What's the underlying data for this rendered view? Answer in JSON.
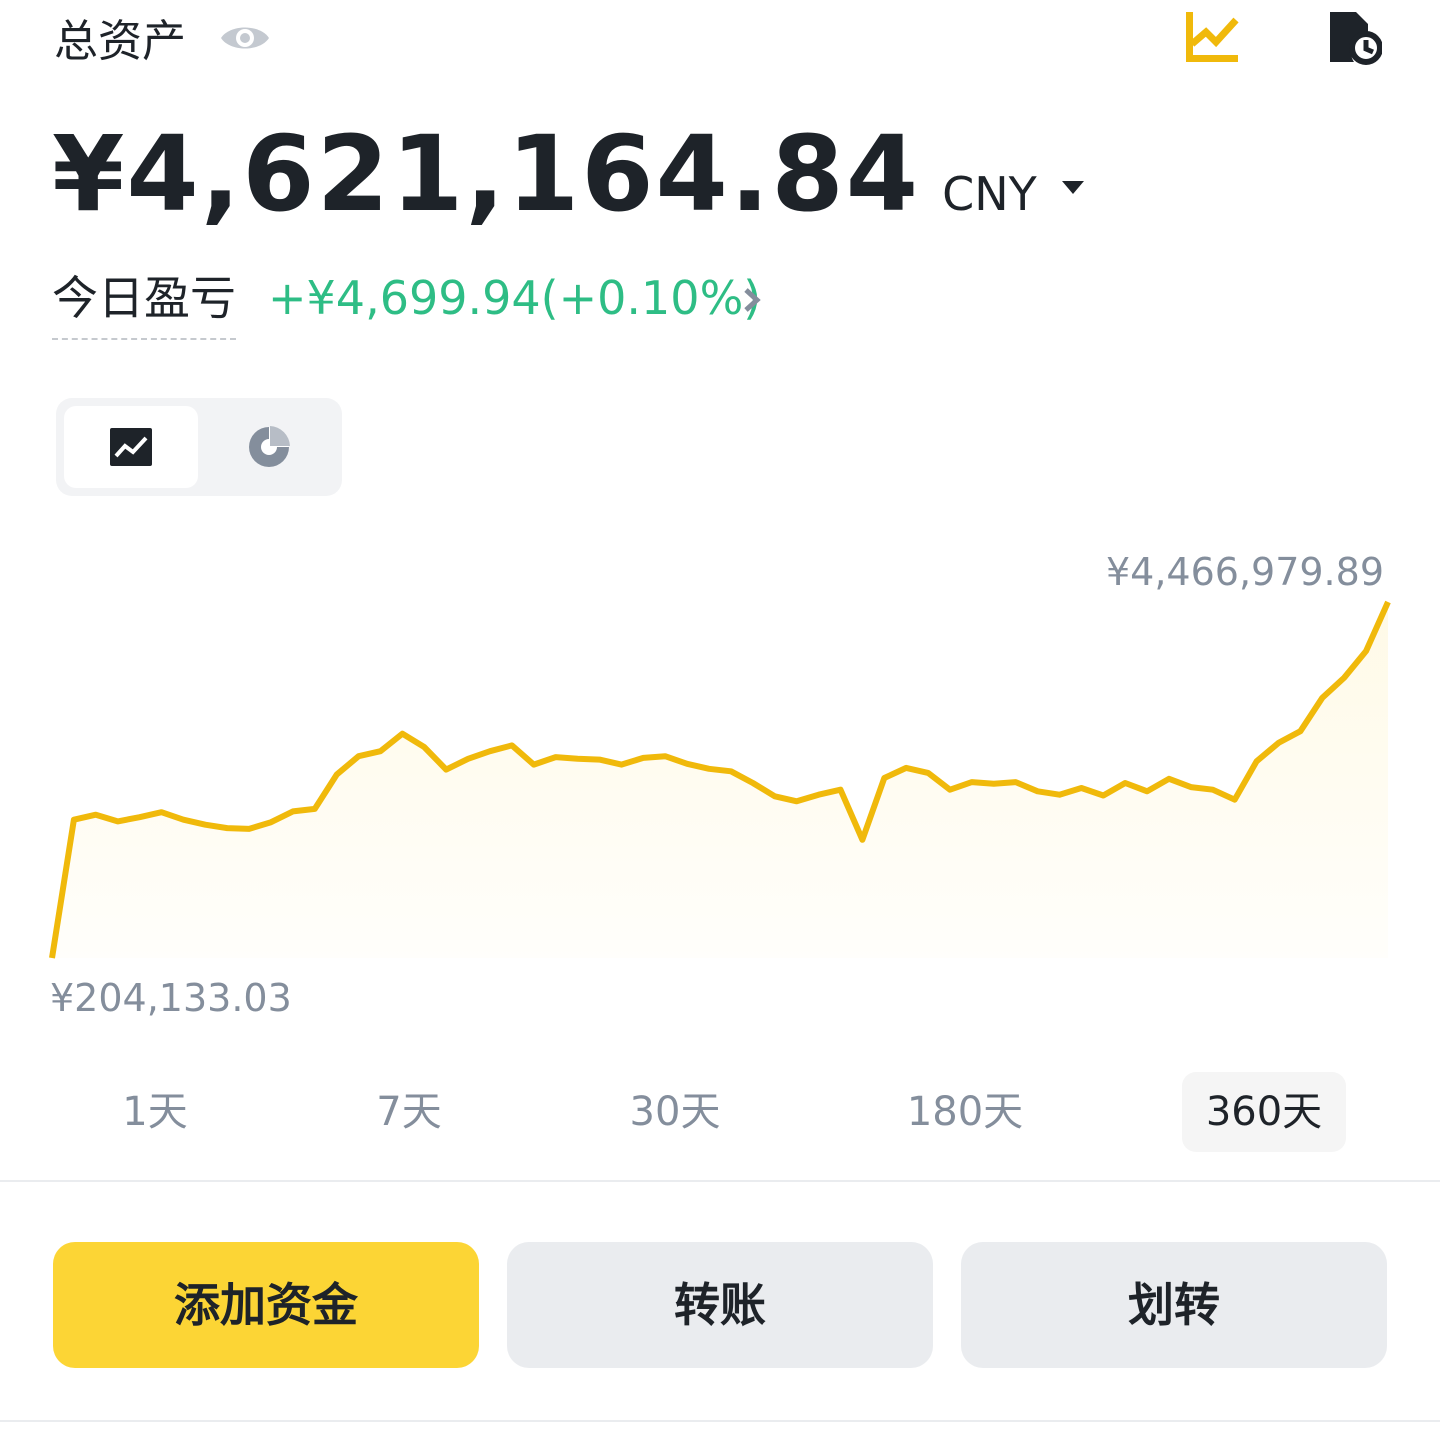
{
  "header": {
    "title": "总资产"
  },
  "balance": {
    "amount": "¥4,621,164.84",
    "currency": "CNY"
  },
  "pnl": {
    "label": "今日盈亏",
    "value": "+¥4,699.94(+0.10%)"
  },
  "colors": {
    "accent": "#fcd535",
    "line": "#f0b90b",
    "positive": "#2ebd85",
    "muted": "#848e9c",
    "text": "#1e2329"
  },
  "icons": {
    "header_left": "eye-icon",
    "header_right": [
      "chart-analysis-icon",
      "history-icon"
    ],
    "view_toggle": [
      "line-chart-icon",
      "pie-chart-icon"
    ]
  },
  "view_toggle": {
    "selected": "line-chart"
  },
  "chart_data": {
    "type": "area",
    "title": "",
    "xlabel": "",
    "ylabel": "",
    "max_label": "¥4,466,979.89",
    "min_label": "¥204,133.03",
    "ylim": [
      204133.03,
      4466979.89
    ],
    "grid": false,
    "legend": "none",
    "series": [
      {
        "values": [
          204133,
          1860000,
          1920000,
          1840000,
          1890000,
          1950000,
          1860000,
          1800000,
          1760000,
          1750000,
          1830000,
          1960000,
          1990000,
          2400000,
          2620000,
          2680000,
          2890000,
          2730000,
          2460000,
          2590000,
          2680000,
          2750000,
          2520000,
          2610000,
          2590000,
          2580000,
          2520000,
          2600000,
          2620000,
          2530000,
          2470000,
          2440000,
          2300000,
          2140000,
          2080000,
          2160000,
          2220000,
          1620000,
          2360000,
          2480000,
          2420000,
          2220000,
          2310000,
          2290000,
          2310000,
          2200000,
          2160000,
          2240000,
          2150000,
          2300000,
          2200000,
          2350000,
          2250000,
          2220000,
          2100000,
          2560000,
          2780000,
          2920000,
          3320000,
          3560000,
          3880000,
          4466980
        ]
      }
    ]
  },
  "periods": [
    {
      "label": "1天",
      "active": false
    },
    {
      "label": "7天",
      "active": false
    },
    {
      "label": "30天",
      "active": false
    },
    {
      "label": "180天",
      "active": false
    },
    {
      "label": "360天",
      "active": true
    }
  ],
  "actions": {
    "deposit": "添加资金",
    "transfer": "转账",
    "internal_transfer": "划转"
  }
}
